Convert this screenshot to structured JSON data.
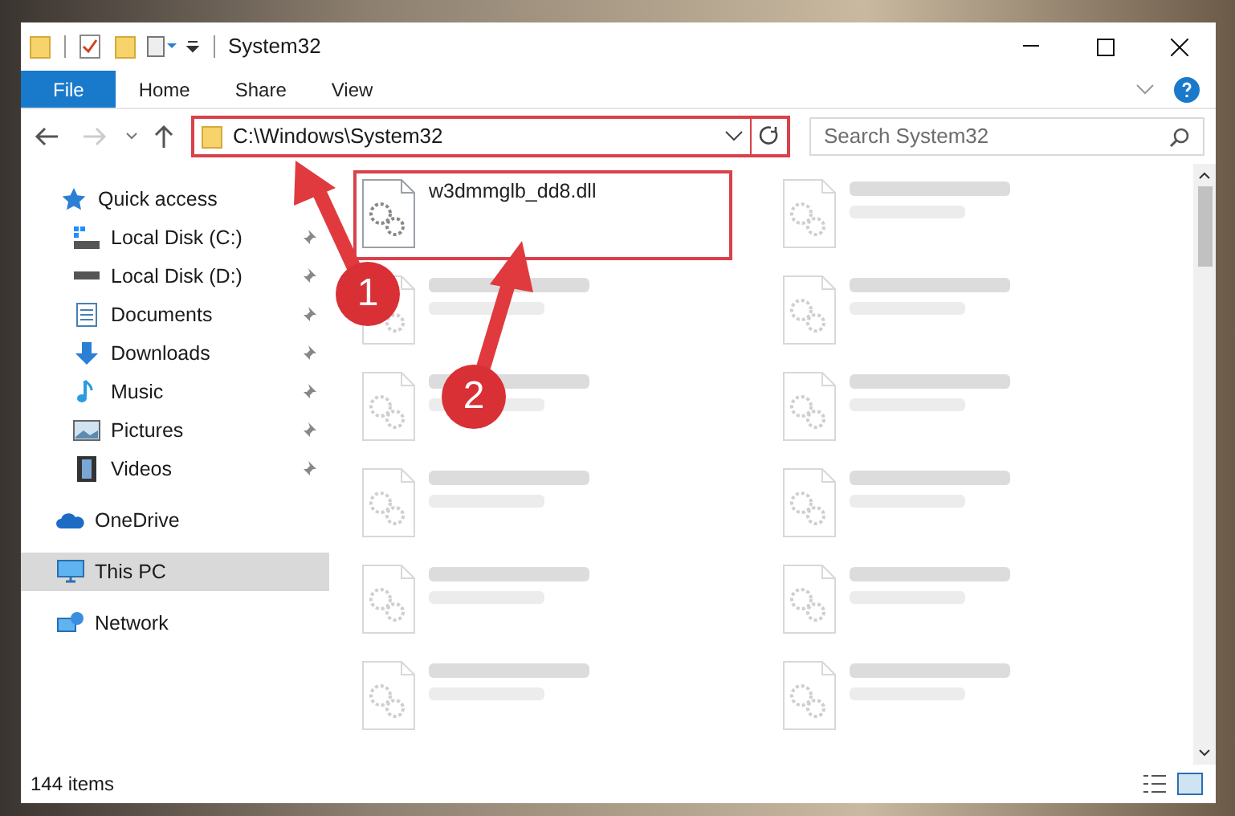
{
  "window": {
    "title": "System32"
  },
  "ribbon_tabs": [
    {
      "label": "File",
      "selected": true
    },
    {
      "label": "Home",
      "selected": false
    },
    {
      "label": "Share",
      "selected": false
    },
    {
      "label": "View",
      "selected": false
    }
  ],
  "address_bar": {
    "path": "C:\\Windows\\System32",
    "highlighted": true
  },
  "search": {
    "placeholder": "Search System32"
  },
  "sidebar": {
    "items": [
      {
        "label": "Quick access",
        "kind": "star",
        "pinned": false,
        "selected": false,
        "group_start": false
      },
      {
        "label": "Local Disk (C:)",
        "kind": "disk-c",
        "pinned": true,
        "selected": false,
        "group_start": false
      },
      {
        "label": "Local Disk (D:)",
        "kind": "disk",
        "pinned": true,
        "selected": false,
        "group_start": false
      },
      {
        "label": "Documents",
        "kind": "documents",
        "pinned": true,
        "selected": false,
        "group_start": false
      },
      {
        "label": "Downloads",
        "kind": "downloads",
        "pinned": true,
        "selected": false,
        "group_start": false
      },
      {
        "label": "Music",
        "kind": "music",
        "pinned": true,
        "selected": false,
        "group_start": false
      },
      {
        "label": "Pictures",
        "kind": "pictures",
        "pinned": true,
        "selected": false,
        "group_start": false
      },
      {
        "label": "Videos",
        "kind": "videos",
        "pinned": true,
        "selected": false,
        "group_start": false
      },
      {
        "label": "OneDrive",
        "kind": "cloud",
        "pinned": false,
        "selected": false,
        "group_start": true
      },
      {
        "label": "This PC",
        "kind": "pc",
        "pinned": false,
        "selected": true,
        "group_start": true
      },
      {
        "label": "Network",
        "kind": "network",
        "pinned": false,
        "selected": false,
        "group_start": true
      }
    ]
  },
  "files": [
    {
      "name": "w3dmmglb_dd8.dll",
      "faded": false,
      "highlighted": true
    },
    {
      "faded": true,
      "highlighted": false
    },
    {
      "faded": true,
      "highlighted": false
    },
    {
      "faded": true,
      "highlighted": false
    },
    {
      "faded": true,
      "highlighted": false
    },
    {
      "faded": true,
      "highlighted": false
    },
    {
      "faded": true,
      "highlighted": false
    },
    {
      "faded": true,
      "highlighted": false
    },
    {
      "faded": true,
      "highlighted": false
    },
    {
      "faded": true,
      "highlighted": false
    },
    {
      "faded": true,
      "highlighted": false
    },
    {
      "faded": true,
      "highlighted": false
    }
  ],
  "status_bar": {
    "count": "144 items"
  },
  "annotations": [
    {
      "number": "1"
    },
    {
      "number": "2"
    }
  ]
}
